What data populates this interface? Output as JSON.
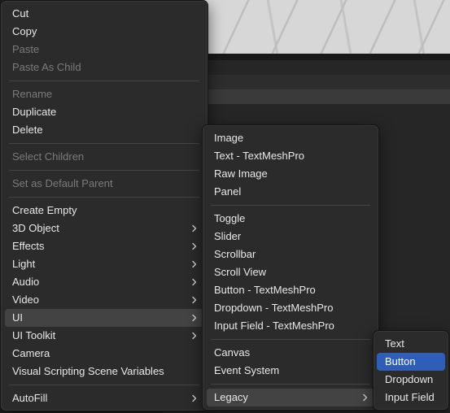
{
  "main_menu": {
    "groups": [
      [
        {
          "label": "Cut",
          "state": "enabled"
        },
        {
          "label": "Copy",
          "state": "enabled"
        },
        {
          "label": "Paste",
          "state": "disabled"
        },
        {
          "label": "Paste As Child",
          "state": "disabled"
        }
      ],
      [
        {
          "label": "Rename",
          "state": "disabled"
        },
        {
          "label": "Duplicate",
          "state": "enabled"
        },
        {
          "label": "Delete",
          "state": "enabled"
        }
      ],
      [
        {
          "label": "Select Children",
          "state": "disabled"
        }
      ],
      [
        {
          "label": "Set as Default Parent",
          "state": "disabled"
        }
      ],
      [
        {
          "label": "Create Empty",
          "state": "enabled"
        },
        {
          "label": "3D Object",
          "state": "enabled",
          "submenu": true
        },
        {
          "label": "Effects",
          "state": "enabled",
          "submenu": true
        },
        {
          "label": "Light",
          "state": "enabled",
          "submenu": true
        },
        {
          "label": "Audio",
          "state": "enabled",
          "submenu": true
        },
        {
          "label": "Video",
          "state": "enabled",
          "submenu": true
        },
        {
          "label": "UI",
          "state": "highlighted",
          "submenu": true
        },
        {
          "label": "UI Toolkit",
          "state": "enabled",
          "submenu": true
        },
        {
          "label": "Camera",
          "state": "enabled"
        },
        {
          "label": "Visual Scripting Scene Variables",
          "state": "enabled"
        }
      ],
      [
        {
          "label": "AutoFill",
          "state": "enabled",
          "submenu": true
        }
      ]
    ]
  },
  "ui_submenu": {
    "groups": [
      [
        {
          "label": "Image",
          "state": "enabled"
        },
        {
          "label": "Text - TextMeshPro",
          "state": "enabled"
        },
        {
          "label": "Raw Image",
          "state": "enabled"
        },
        {
          "label": "Panel",
          "state": "enabled"
        }
      ],
      [
        {
          "label": "Toggle",
          "state": "enabled"
        },
        {
          "label": "Slider",
          "state": "enabled"
        },
        {
          "label": "Scrollbar",
          "state": "enabled"
        },
        {
          "label": "Scroll View",
          "state": "enabled"
        },
        {
          "label": "Button - TextMeshPro",
          "state": "enabled"
        },
        {
          "label": "Dropdown - TextMeshPro",
          "state": "enabled"
        },
        {
          "label": "Input Field - TextMeshPro",
          "state": "enabled"
        }
      ],
      [
        {
          "label": "Canvas",
          "state": "enabled"
        },
        {
          "label": "Event System",
          "state": "enabled"
        }
      ],
      [
        {
          "label": "Legacy",
          "state": "highlighted",
          "submenu": true
        }
      ]
    ]
  },
  "legacy_submenu": {
    "groups": [
      [
        {
          "label": "Text",
          "state": "enabled"
        },
        {
          "label": "Button",
          "state": "selected"
        },
        {
          "label": "Dropdown",
          "state": "enabled"
        },
        {
          "label": "Input Field",
          "state": "enabled"
        }
      ]
    ]
  },
  "icons": {
    "submenu_arrow": "chevron-right-icon"
  },
  "colors": {
    "menu_bg": "#2b2b2b",
    "highlight": "#434343",
    "selected": "#2f5eb8",
    "text": "#e8e8e8",
    "disabled_text": "#7b7b7b"
  }
}
